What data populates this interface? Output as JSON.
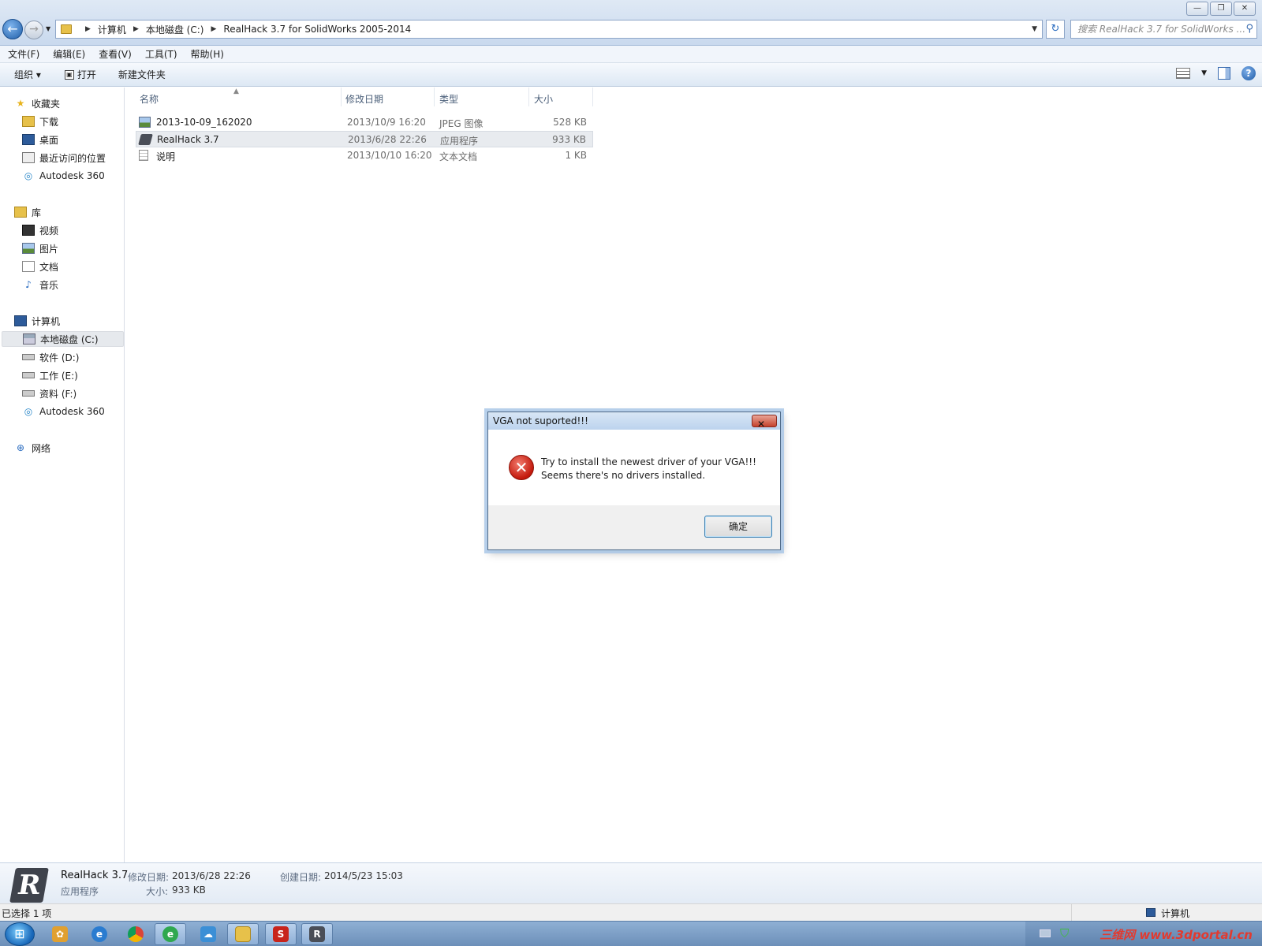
{
  "window": {
    "controls": [
      "—",
      "❐",
      "✕"
    ],
    "breadcrumbs": [
      "计算机",
      "本地磁盘 (C:)",
      "RealHack 3.7 for SolidWorks 2005-2014"
    ],
    "search_placeholder": "搜索 RealHack 3.7 for SolidWorks ..."
  },
  "menu": [
    "文件(F)",
    "编辑(E)",
    "查看(V)",
    "工具(T)",
    "帮助(H)"
  ],
  "commands": {
    "organize": "组织 ▾",
    "open": "打开",
    "new_folder": "新建文件夹"
  },
  "nav": {
    "favorites": {
      "title": "收藏夹",
      "items": [
        "下载",
        "桌面",
        "最近访问的位置",
        "Autodesk 360"
      ]
    },
    "libraries": {
      "title": "库",
      "items": [
        "视频",
        "图片",
        "文档",
        "音乐"
      ]
    },
    "computer": {
      "title": "计算机",
      "items": [
        "本地磁盘 (C:)",
        "软件 (D:)",
        "工作 (E:)",
        "资料 (F:)",
        "Autodesk 360"
      ]
    },
    "network": {
      "title": "网络"
    }
  },
  "columns": [
    "名称",
    "修改日期",
    "类型",
    "大小"
  ],
  "files": [
    {
      "name": "2013-10-09_162020",
      "date": "2013/10/9 16:20",
      "type": "JPEG 图像",
      "size": "528 KB",
      "icon": "image-icon"
    },
    {
      "name": "RealHack 3.7",
      "date": "2013/6/28 22:26",
      "type": "应用程序",
      "size": "933 KB",
      "icon": "app-icon"
    },
    {
      "name": "说明",
      "date": "2013/10/10 16:20",
      "type": "文本文档",
      "size": "1 KB",
      "icon": "text-file-icon"
    }
  ],
  "details": {
    "name": "RealHack 3.7",
    "type": "应用程序",
    "modified_label": "修改日期:",
    "modified": "2013/6/28 22:26",
    "created_label": "创建日期:",
    "created": "2014/5/23 15:03",
    "size_label": "大小:",
    "size": "933 KB"
  },
  "status": {
    "selected": "已选择 1 项",
    "location": "计算机"
  },
  "dialog": {
    "title": "VGA not suported!!!",
    "line1": "Try to install the newest driver of your VGA!!!",
    "line2": "Seems there's no drivers installed.",
    "ok": "确定"
  },
  "taskbar": {
    "watermark": "三维网 www.3dportal.cn"
  }
}
